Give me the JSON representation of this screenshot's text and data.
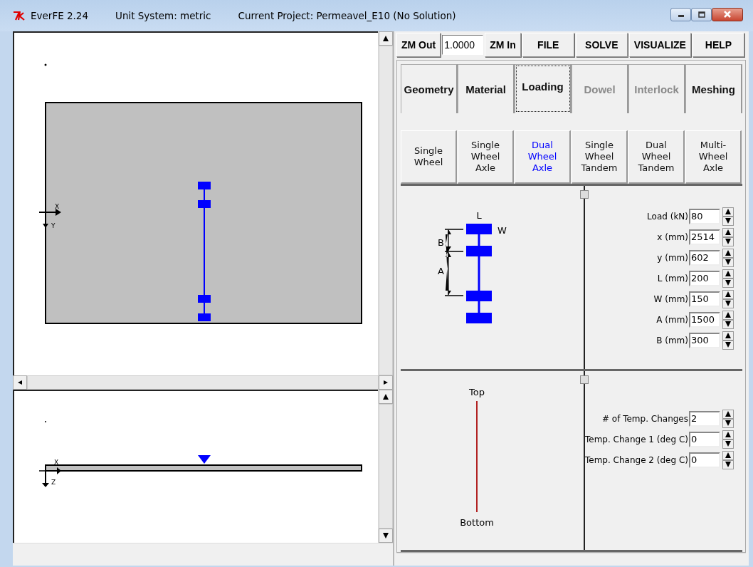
{
  "window": {
    "title": "EverFE 2.24",
    "unit_system": "Unit System: metric",
    "project": "Current Project: Permeavel_E10 (No Solution)"
  },
  "plan_view": {
    "x_label": "X",
    "y_label": "Y"
  },
  "elevation_view": {
    "x_label": "X",
    "z_label": "Z"
  },
  "toolbar": {
    "zoom_out": "ZM Out",
    "zoom_value": "1.0000",
    "zoom_in": "ZM In",
    "menus": [
      "FILE",
      "SOLVE",
      "VISUALIZE",
      "HELP"
    ]
  },
  "tabs": [
    {
      "label": "Geometry",
      "selected": false,
      "disabled": false
    },
    {
      "label": "Material",
      "selected": false,
      "disabled": false
    },
    {
      "label": "Loading",
      "selected": true,
      "disabled": false
    },
    {
      "label": "Dowel",
      "selected": false,
      "disabled": true
    },
    {
      "label": "Interlock",
      "selected": false,
      "disabled": true
    },
    {
      "label": "Meshing",
      "selected": false,
      "disabled": false
    }
  ],
  "load_types": [
    {
      "label": "Single\nWheel",
      "selected": false
    },
    {
      "label": "Single\nWheel\nAxle",
      "selected": false
    },
    {
      "label": "Dual\nWheel\nAxle",
      "selected": true
    },
    {
      "label": "Single\nWheel\nTandem",
      "selected": false
    },
    {
      "label": "Dual\nWheel\nTandem",
      "selected": false
    },
    {
      "label": "Multi-\nWheel\nAxle",
      "selected": false
    }
  ],
  "load_diagram": {
    "length_label": "L",
    "width_label": "W",
    "spacing_b_label": "B",
    "spacing_a_label": "A"
  },
  "load_fields": [
    {
      "label": "Load (kN)",
      "value": "80"
    },
    {
      "label": "x (mm)",
      "value": "2514"
    },
    {
      "label": "y (mm)",
      "value": "602"
    },
    {
      "label": "L (mm)",
      "value": "200"
    },
    {
      "label": "W (mm)",
      "value": "150"
    },
    {
      "label": "A (mm)",
      "value": "1500"
    },
    {
      "label": "B (mm)",
      "value": "300"
    }
  ],
  "temperature_profile": {
    "top": "Top",
    "bottom": "Bottom"
  },
  "temperature_fields": [
    {
      "label": "# of Temp. Changes",
      "value": "2"
    },
    {
      "label": "Temp. Change 1 (deg C)",
      "value": "0"
    },
    {
      "label": "Temp. Change 2 (deg C)",
      "value": "0"
    }
  ]
}
